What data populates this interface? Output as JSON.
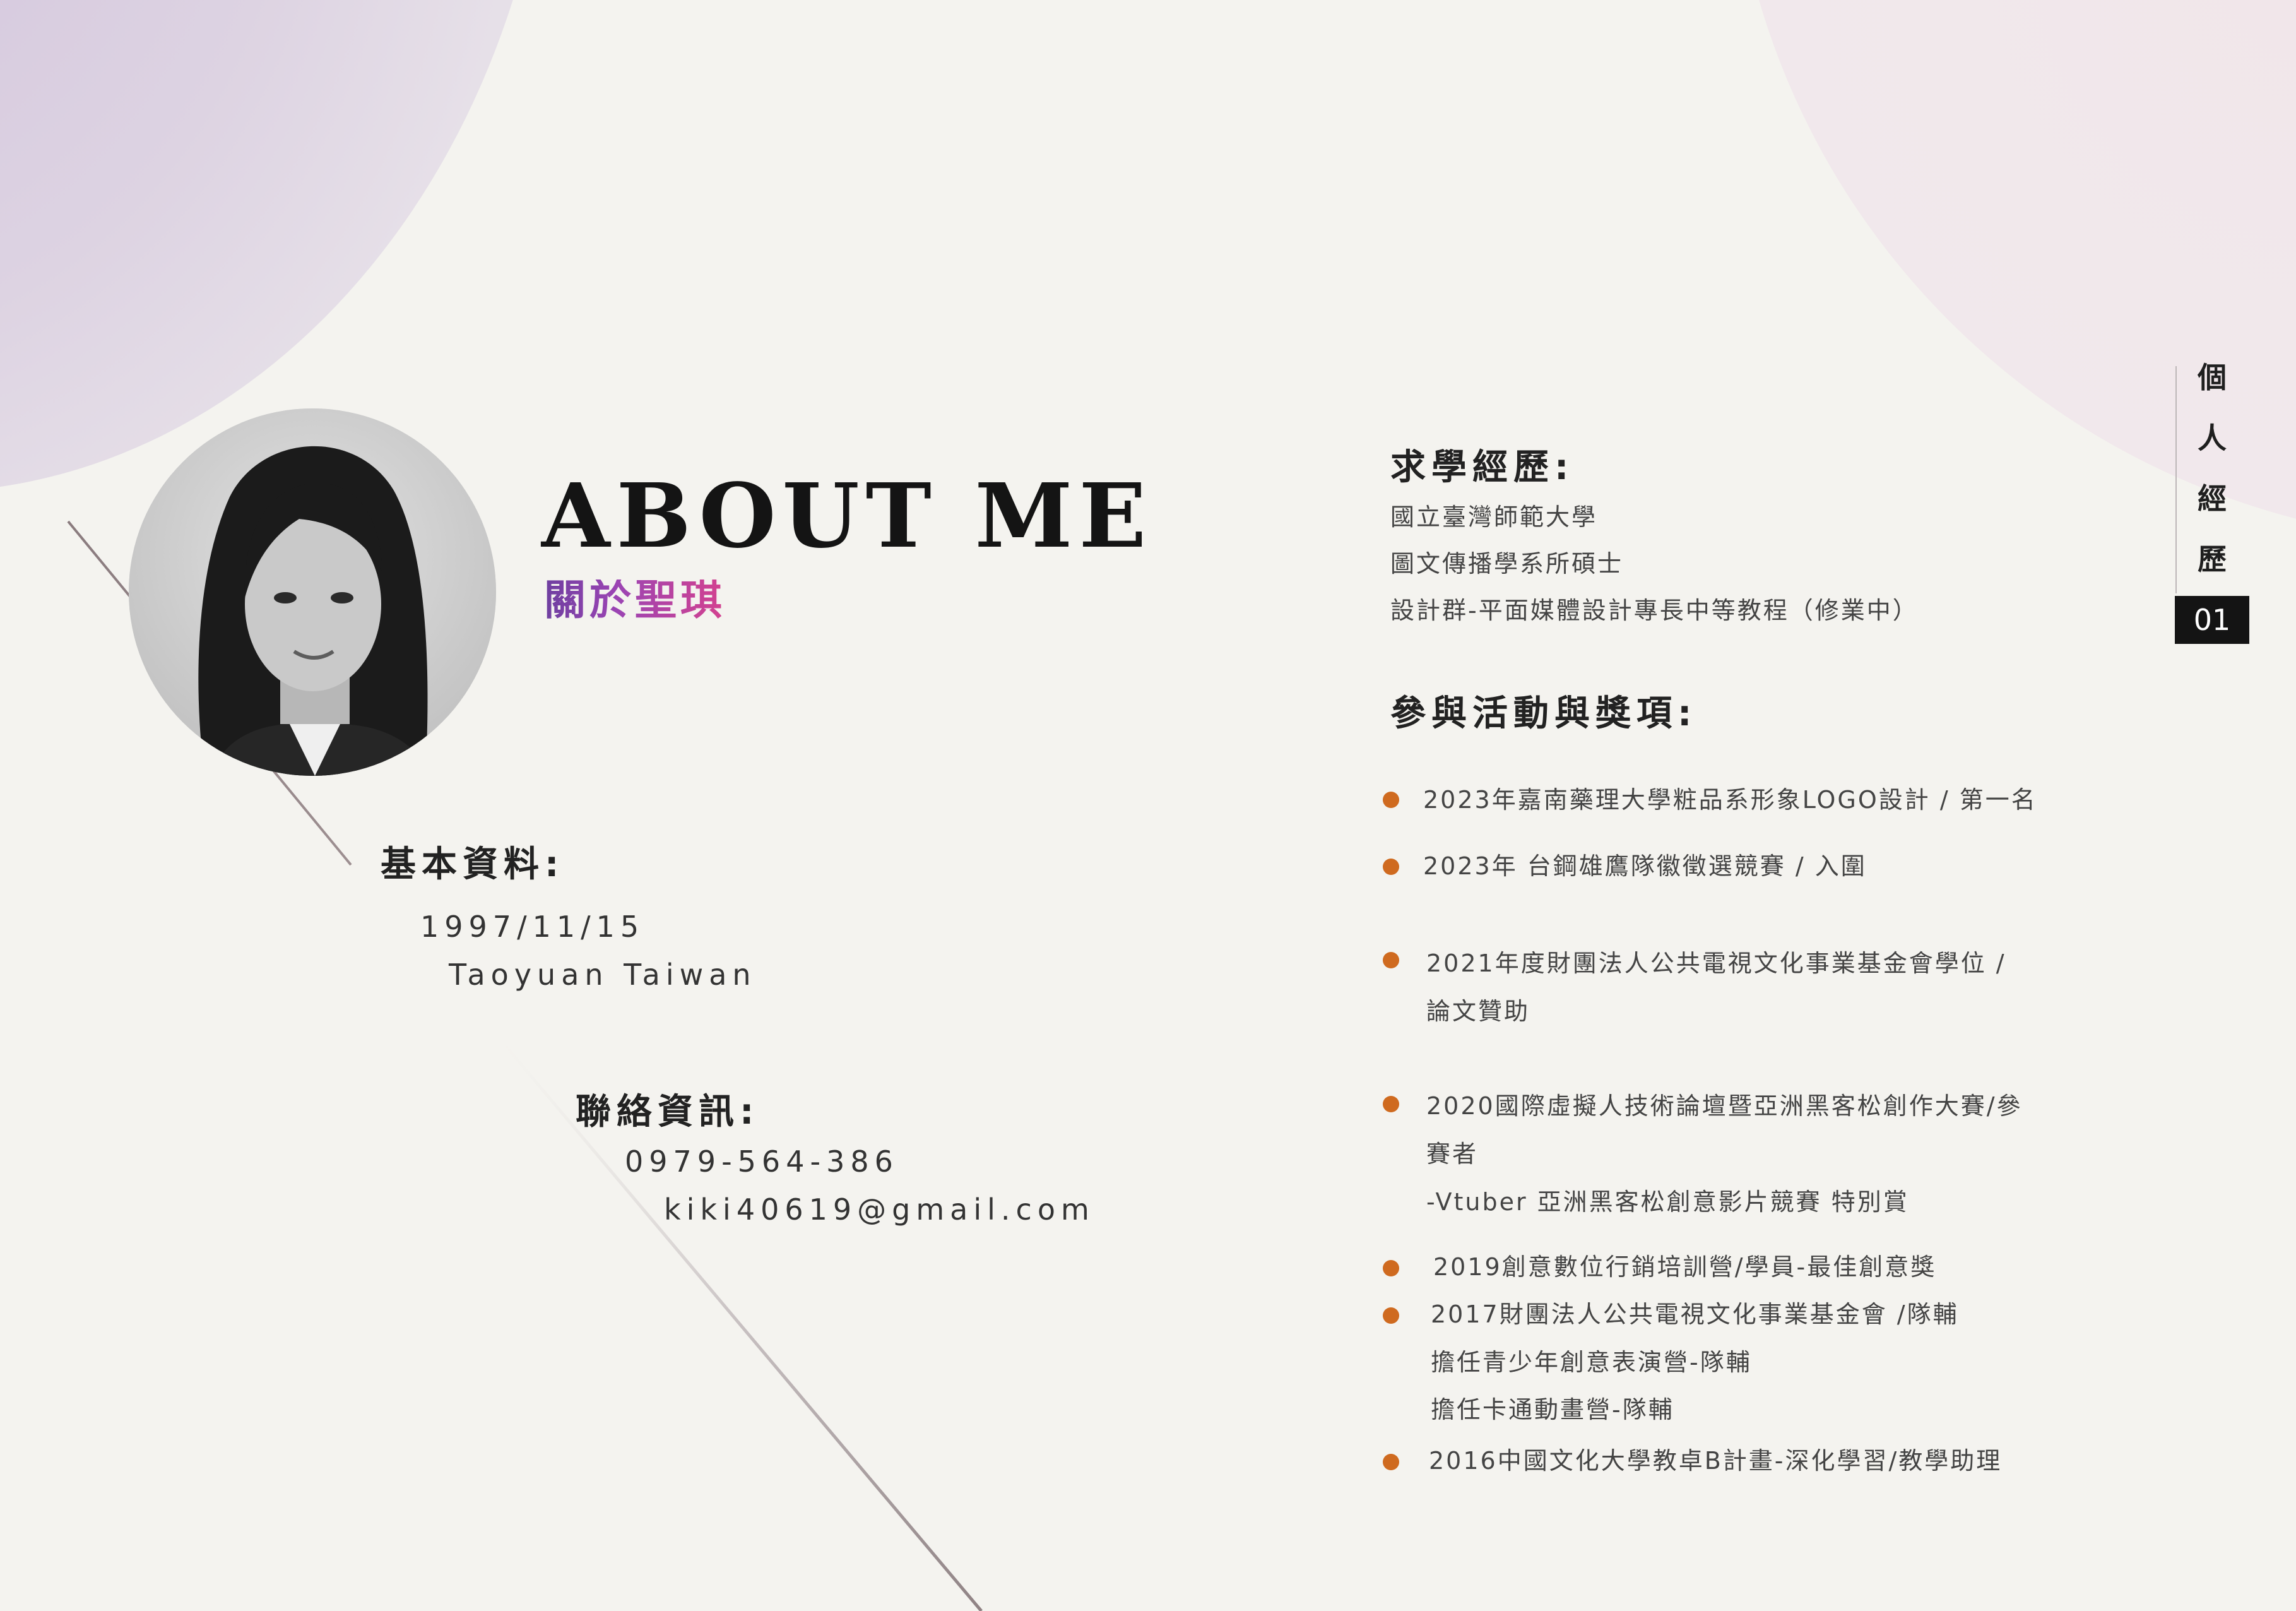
{
  "header": {
    "title": "ABOUT ME",
    "subtitle": "關於聖琪"
  },
  "basic_info": {
    "heading": "基本資料:",
    "birthday": "1997/11/15",
    "location": "Taoyuan Taiwan"
  },
  "contact": {
    "heading": "聯絡資訊:",
    "phone": "0979-564-386",
    "email": "kiki40619@gmail.com"
  },
  "education": {
    "heading": "求學經歷:",
    "items": [
      "國立臺灣師範大學",
      "圖文傳播學系所碩士",
      "設計群-平面媒體設計專長中等教程（修業中）"
    ]
  },
  "awards": {
    "heading": "參與活動與獎項:",
    "items": [
      {
        "lines": [
          "2023年嘉南藥理大學粧品系形象LOGO設計 / 第一名"
        ]
      },
      {
        "lines": [
          "2023年 台鋼雄鷹隊徽徵選競賽   /   入圍"
        ]
      },
      {
        "lines": [
          "2021年度財團法人公共電視文化事業基金會學位 /",
          "論文贊助"
        ]
      },
      {
        "lines": [
          "2020國際虛擬人技術論壇暨亞洲黑客松創作大賽/參",
          "賽者",
          "-Vtuber 亞洲黑客松創意影片競賽 特別賞"
        ]
      },
      {
        "lines": [
          "2019創意數位行銷培訓營/學員-最佳創意獎"
        ]
      },
      {
        "lines": [
          "2017財團法人公共電視文化事業基金會 /隊輔",
          "擔任青少年創意表演營-隊輔",
          "擔任卡通動畫營-隊輔"
        ]
      },
      {
        "lines": [
          "2016中國文化大學教卓B計畫-深化學習/教學助理"
        ]
      }
    ]
  },
  "side_tab": {
    "chars": [
      "個",
      "人",
      "經",
      "歷"
    ],
    "page_number": "01"
  },
  "colors": {
    "background": "#f4f3ef",
    "bullet": "#cf6a1f",
    "subtitle_gradient_start": "#6e3fa0",
    "subtitle_gradient_end": "#d4428f",
    "tab_badge": "#141414"
  }
}
